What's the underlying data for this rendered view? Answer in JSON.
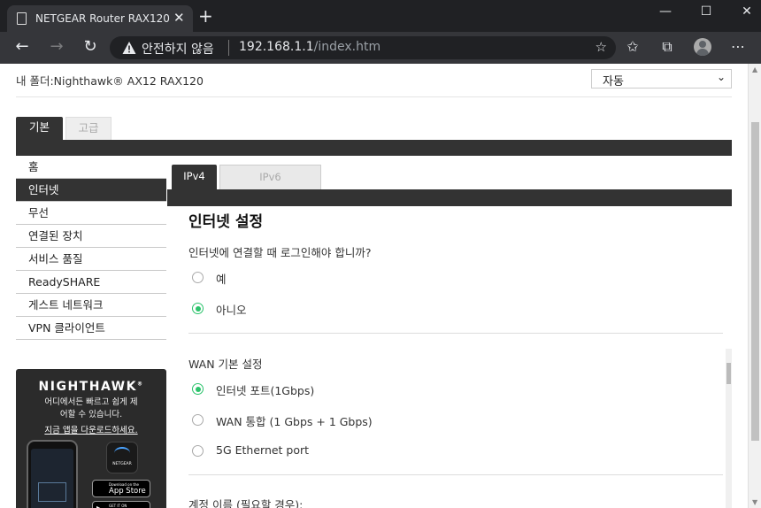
{
  "browser": {
    "tab_title": "NETGEAR Router RAX120",
    "security_label": "안전하지 않음",
    "url_host": "192.168.1.1",
    "url_path": "/index.htm"
  },
  "header": {
    "folder_label": "내 폴더:Nighthawk® AX12 RAX120",
    "language_selected": "자동"
  },
  "main_tabs": [
    {
      "label": "기본"
    },
    {
      "label": "고급"
    }
  ],
  "menu": {
    "items": [
      {
        "label": "홈"
      },
      {
        "label": "인터넷"
      },
      {
        "label": "무선"
      },
      {
        "label": "연결된 장치"
      },
      {
        "label": "서비스 품질"
      },
      {
        "label": "ReadySHARE"
      },
      {
        "label": "게스트 네트워크"
      },
      {
        "label": "VPN 클라이언트"
      }
    ],
    "active_index": 1
  },
  "promo": {
    "brand": "NIGHTHAWK",
    "line1": "어디에서든 빠르고 쉽게 제",
    "line2": "어할 수 있습니다.",
    "link": "지금 앱을 다운로드하세요.",
    "app_icon_label": "NETGEAR",
    "app_store_small": "Download on the",
    "app_store_big": "App Store",
    "play_small": "GET IT ON"
  },
  "sub_tabs": [
    {
      "label": "IPv4"
    },
    {
      "label": "IPv6"
    }
  ],
  "internet": {
    "title": "인터넷 설정",
    "login_question": "인터넷에 연결할 때 로그인해야 합니까?",
    "login_options": [
      {
        "label": "예",
        "checked": false
      },
      {
        "label": "아니오",
        "checked": true
      }
    ],
    "wan_title": "WAN 기본 설정",
    "wan_options": [
      {
        "label": "인터넷 포트(1Gbps)",
        "checked": true
      },
      {
        "label": "WAN 통합 (1 Gbps + 1 Gbps)",
        "checked": false
      },
      {
        "label": "5G Ethernet port",
        "checked": false
      }
    ],
    "account_label": "계정 이름 (필요할 경우):"
  },
  "colors": {
    "accent_green": "#2bc36b",
    "dark_bar": "#333333",
    "browser_dark": "#202124"
  }
}
